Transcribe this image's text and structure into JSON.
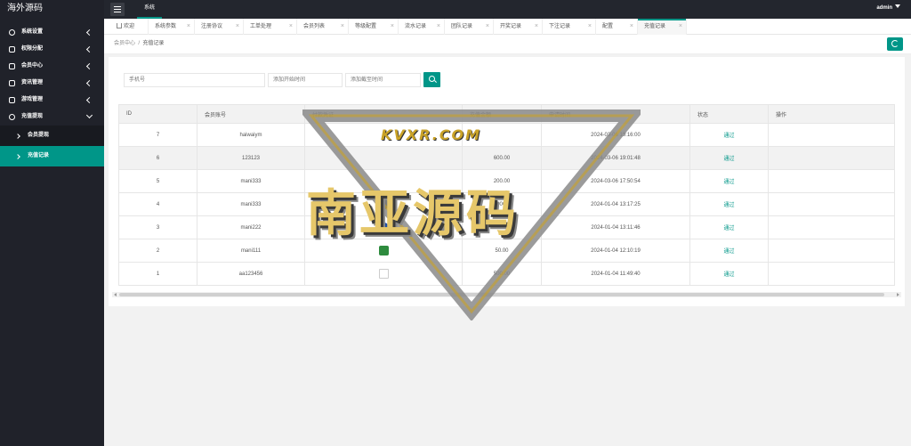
{
  "header": {
    "logo": "海外源码",
    "top_tab": "系统",
    "user": "admin"
  },
  "sidebar": {
    "items": [
      {
        "label": "系统设置",
        "icon": "gear-icon"
      },
      {
        "label": "权限分配",
        "icon": "user-icon"
      },
      {
        "label": "会员中心",
        "icon": "user-icon"
      },
      {
        "label": "资讯管理",
        "icon": "list-icon"
      },
      {
        "label": "游戏管理",
        "icon": "monitor-icon"
      },
      {
        "label": "充值提现",
        "icon": "gear-icon"
      }
    ],
    "sub_items": [
      {
        "label": "会员提现"
      },
      {
        "label": "充值记录"
      }
    ]
  },
  "tabs": [
    {
      "label": "欢迎",
      "icon": "home-icon"
    },
    {
      "label": "系统参数"
    },
    {
      "label": "注册协议"
    },
    {
      "label": "工单处理"
    },
    {
      "label": "会员列表"
    },
    {
      "label": "等级配置"
    },
    {
      "label": "流水记录"
    },
    {
      "label": "团队记录"
    },
    {
      "label": "开奖记录"
    },
    {
      "label": "下注记录"
    },
    {
      "label": "配置"
    },
    {
      "label": "充值记录"
    }
  ],
  "breadcrumb": {
    "parent": "会员中心",
    "separator": "/",
    "current": "充值记录"
  },
  "filters": {
    "phone_placeholder": "手机号",
    "start_placeholder": "添加开始时间",
    "end_placeholder": "添加截至时间"
  },
  "table": {
    "headers": [
      "ID",
      "会员账号",
      "付款凭证",
      "充值金额",
      "申请时间",
      "状态",
      "操作"
    ],
    "rows": [
      {
        "id": "7",
        "account": "haiwaiym",
        "amount": "",
        "time": "2024-03-06 19:16:00",
        "status": "通过"
      },
      {
        "id": "6",
        "account": "123123",
        "amount": "600.00",
        "time": "2024-03-06 19:01:48",
        "status": "通过"
      },
      {
        "id": "5",
        "account": "mani333",
        "amount": "200.00",
        "time": "2024-03-06 17:50:54",
        "status": "通过"
      },
      {
        "id": "4",
        "account": "mani333",
        "amount": "15000.00",
        "time": "2024-01-04 13:17:25",
        "status": "通过"
      },
      {
        "id": "3",
        "account": "mani222",
        "amount": "10000.00",
        "time": "2024-01-04 13:11:46",
        "status": "通过"
      },
      {
        "id": "2",
        "account": "mani111",
        "amount": "50.00",
        "time": "2024-01-04 12:10:19",
        "status": "通过"
      },
      {
        "id": "1",
        "account": "aa123456",
        "amount": "500.00",
        "time": "2024-01-04 11:49:40",
        "status": "通过"
      }
    ]
  },
  "watermark": {
    "site": "KVXR.COM",
    "text": "南亚源码"
  },
  "colors": {
    "accent": "#009688",
    "sidebar_bg": "#20222a",
    "header_bg": "#23262e"
  }
}
